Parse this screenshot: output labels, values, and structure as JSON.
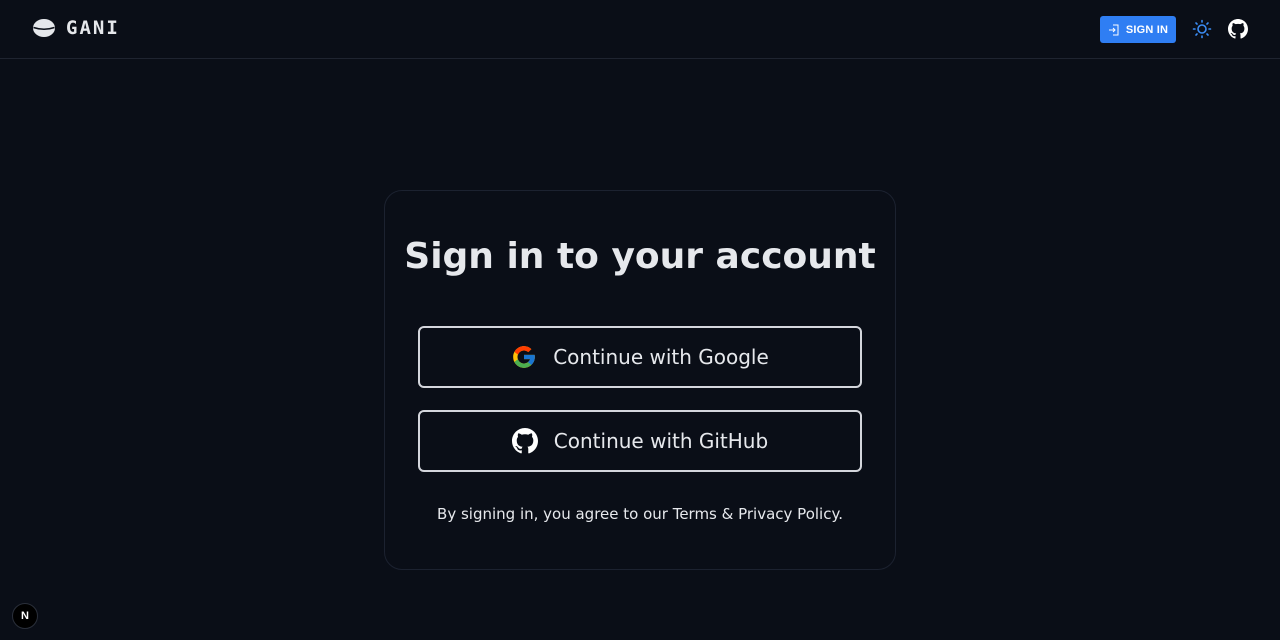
{
  "header": {
    "logo_icon": "planet-icon",
    "brand": "GANI",
    "signin_label": "SIGN IN",
    "signin_icon": "login-icon",
    "theme_icon": "sun-icon",
    "github_icon": "github-icon"
  },
  "card": {
    "title": "Sign in to your account",
    "google_label": "Continue with Google",
    "google_icon": "google-icon",
    "github_label": "Continue with GitHub",
    "github_icon": "github-icon",
    "terms_text": "By signing in, you agree to our Terms & Privacy Policy."
  },
  "dev_badge": {
    "label": "N"
  },
  "colors": {
    "background": "#0a0e17",
    "accent": "#2f7ef3",
    "text": "#e6e8ec",
    "button_border": "#d4d6dc"
  }
}
